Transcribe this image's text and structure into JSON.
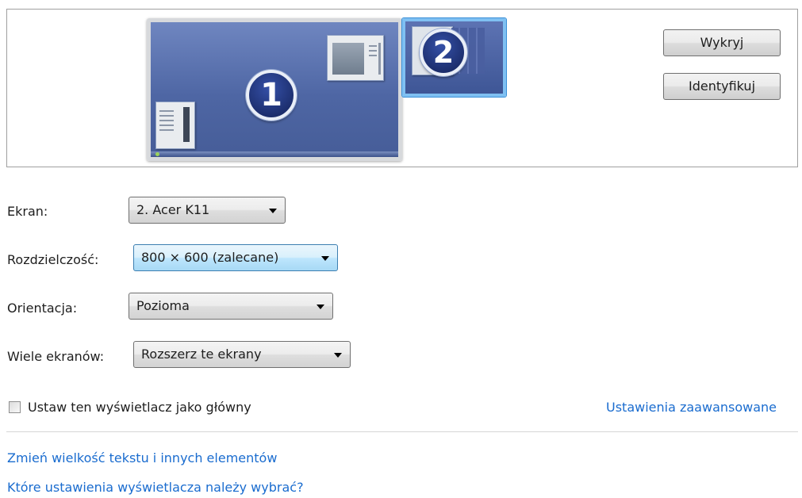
{
  "preview": {
    "monitor1_number": "1",
    "monitor2_number": "2",
    "monitor2_selected": true
  },
  "buttons": {
    "detect": "Wykryj",
    "identify": "Identyfikuj"
  },
  "settings": {
    "display_label": "Ekran:",
    "display_value": "2. Acer K11",
    "resolution_label": "Rozdzielczość:",
    "resolution_value": "800 × 600 (zalecane)",
    "orientation_label": "Orientacja:",
    "orientation_value": "Pozioma",
    "multiple_label": "Wiele ekranów:",
    "multiple_value": "Rozszerz te ekrany"
  },
  "checkbox": {
    "label": "Ustaw ten wyświetlacz jako główny",
    "checked": false
  },
  "links": {
    "advanced": "Ustawienia zaawansowane",
    "text_size": "Zmień wielkość tekstu i innych elementów",
    "which_settings": "Które ustawienia wyświetlacza należy wybrać?"
  },
  "colors": {
    "link": "#1a6ccf",
    "selection_border": "#7fc0f2",
    "desktop": "#516aa6"
  }
}
